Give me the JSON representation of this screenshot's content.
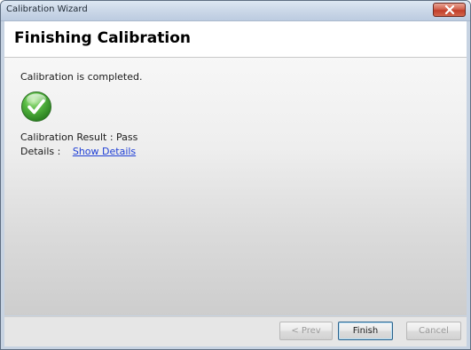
{
  "window": {
    "title": "Calibration Wizard",
    "close_icon": "close-icon"
  },
  "header": {
    "title": "Finishing Calibration"
  },
  "main": {
    "status": "Calibration is completed.",
    "status_icon": "green-checkmark-icon",
    "result_label": "Calibration Result :",
    "result_value": "Pass",
    "details_label": "Details :",
    "details_link": "Show Details"
  },
  "footer": {
    "prev_label": "< Prev",
    "finish_label": "Finish",
    "cancel_label": "Cancel"
  },
  "colors": {
    "link": "#1f3fd6",
    "success_green": "#3aa12e"
  }
}
